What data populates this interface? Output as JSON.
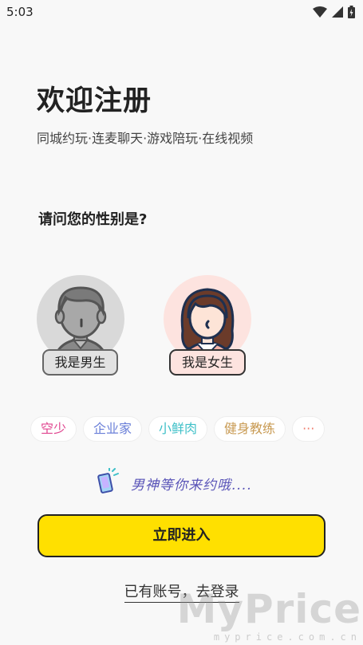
{
  "status_bar": {
    "time": "5:03",
    "icons": [
      "wifi-icon",
      "cell-signal-icon",
      "battery-icon"
    ]
  },
  "header": {
    "title": "欢迎注册",
    "subtitle": "同城约玩·连麦聊天·游戏陪玩·在线视频"
  },
  "gender_question": "请问您的性别是?",
  "gender_options": [
    {
      "label": "我是男生",
      "icon": "male-avatar-icon",
      "color": "#d9d9d9"
    },
    {
      "label": "我是女生",
      "icon": "female-avatar-icon",
      "color": "#fde3df"
    }
  ],
  "tags": [
    {
      "label": "空少",
      "color": "#e0458f"
    },
    {
      "label": "企业家",
      "color": "#6a7fd8"
    },
    {
      "label": "小鲜肉",
      "color": "#3fc0c8"
    },
    {
      "label": "健身教练",
      "color": "#c89a52"
    },
    {
      "label": "···",
      "color": "#f07a6a"
    }
  ],
  "slogan": {
    "text": "男神等你来约哦....",
    "icon": "phone-ring-icon",
    "color": "#5a55b8"
  },
  "enter_button": {
    "label": "立即进入",
    "color": "#ffe000"
  },
  "login_link": "已有账号，去登录",
  "watermark": {
    "logo": "MyPrice",
    "url": "myprice.com.cn"
  }
}
